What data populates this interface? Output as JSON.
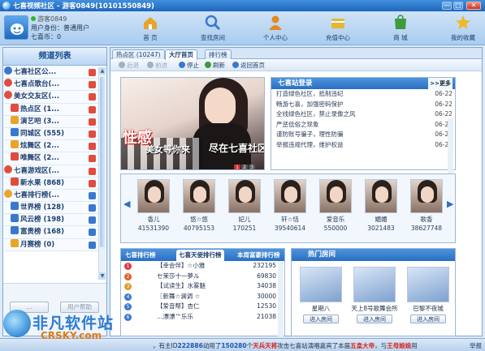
{
  "window": {
    "title": "七喜视频社区 - 游客0849(10101550849)",
    "min": "—",
    "max": "□",
    "close": "✕"
  },
  "user": {
    "name": "游客0849",
    "type": "用户身份：普通用户",
    "coins": "七喜币：0"
  },
  "nav": [
    {
      "label": "首 页",
      "icon": "home-icon",
      "color": "#e9a42a"
    },
    {
      "label": "查找房间",
      "icon": "search-icon",
      "color": "#3a78cf"
    },
    {
      "label": "个人中心",
      "icon": "person-icon",
      "color": "#e28b1e"
    },
    {
      "label": "充值中心",
      "icon": "recharge-icon",
      "color": "#e6b532"
    },
    {
      "label": "商 城",
      "icon": "shop-icon",
      "color": "#3e9a3b"
    },
    {
      "label": "我的收藏",
      "icon": "star-icon",
      "color": "#f0b72a"
    }
  ],
  "left": {
    "title": "频道列表",
    "channels": [
      {
        "label": "七喜社区公...",
        "kind": "cat",
        "color": "#3a78cf",
        "badge": "red"
      },
      {
        "label": "七喜点歌台(...",
        "kind": "cat",
        "color": "#e04d3e",
        "badge": "red"
      },
      {
        "label": "美女交友区(...",
        "kind": "cat",
        "color": "#e04d3e",
        "badge": "red"
      },
      {
        "label": "热点区 (1...",
        "kind": "sub",
        "color": "#e04d3e",
        "badge": "red"
      },
      {
        "label": "演艺吧 (3...",
        "kind": "sub",
        "color": "#e9a42a",
        "badge": "red"
      },
      {
        "label": "同城区 (555)",
        "kind": "sub",
        "color": "#3a78cf",
        "badge": "red"
      },
      {
        "label": "炫舞区 (2...",
        "kind": "sub",
        "color": "#e9a42a",
        "badge": "red"
      },
      {
        "label": "唯舞区 (2...",
        "kind": "sub",
        "color": "#e04d3e",
        "badge": "red"
      },
      {
        "label": "七喜游戏区(...",
        "kind": "cat",
        "color": "#e04d3e",
        "badge": "red"
      },
      {
        "label": "新水果 (868)",
        "kind": "sub",
        "color": "#e04d3e",
        "badge": "red"
      },
      {
        "label": "七喜排行榜(...",
        "kind": "cat",
        "color": "#e9a42a",
        "badge": "blue"
      },
      {
        "label": "世界榜 (128)",
        "kind": "sub",
        "color": "#3a78cf",
        "badge": "blue"
      },
      {
        "label": "风云榜 (198)",
        "kind": "sub",
        "color": "#3a78cf",
        "badge": "blue"
      },
      {
        "label": "富贵榜 (168)",
        "kind": "sub",
        "color": "#3a78cf",
        "badge": "blue"
      },
      {
        "label": "月赛榜 (0)",
        "kind": "sub",
        "color": "#e9a42a",
        "badge": "blue"
      }
    ],
    "btn_left": "…",
    "btn_right": "用户帮助"
  },
  "tabs": [
    {
      "label": "热点区 (10247)",
      "active": false
    },
    {
      "label": "大厅首页",
      "active": true
    },
    {
      "label": "排行榜",
      "active": false
    }
  ],
  "toolbar": [
    {
      "label": "后退",
      "off": true,
      "color": "#9fb2c8"
    },
    {
      "label": "前进",
      "off": true,
      "color": "#9fb2c8"
    },
    {
      "label": "停止",
      "off": false,
      "color": "#3a78cf"
    },
    {
      "label": "刷新",
      "off": false,
      "color": "#3e9a3b"
    },
    {
      "label": "返回首页",
      "off": false,
      "color": "#3a78cf"
    }
  ],
  "banner": {
    "big": "性感",
    "sub": "美女等你来",
    "sub2": "尽在七喜社区",
    "pages": [
      "1",
      "2",
      "3"
    ]
  },
  "news": {
    "title": "七喜站登录",
    "more": ">>更多",
    "items": [
      {
        "text": "打造绿色社区，抵制违纪",
        "date": "06-22"
      },
      {
        "text": "畅游七喜，加强密码保护",
        "date": "06-22"
      },
      {
        "text": "全线绿色社区，禁止录像之风",
        "date": "06-22"
      },
      {
        "text": "严惩低俗之现象",
        "date": "06-22"
      },
      {
        "text": "谨防账号骗子，理性防骗",
        "date": "06-22"
      },
      {
        "text": "举报违规代理，维护权益",
        "date": "06-22"
      }
    ]
  },
  "stars": [
    {
      "name": "香儿",
      "value": "41531390"
    },
    {
      "name": "悠☆悠",
      "value": "40795153"
    },
    {
      "name": "妃儿",
      "value": "170251"
    },
    {
      "name": "轩☆恬",
      "value": "39540614"
    },
    {
      "name": "爱音乐",
      "value": "550000"
    },
    {
      "name": "媚媚",
      "value": "3021483"
    },
    {
      "name": "歌香",
      "value": "38627748"
    }
  ],
  "ranking": {
    "tabs": [
      "七喜排行榜",
      "七喜天使排行榜",
      "本周富豪排行榜"
    ],
    "rows": [
      {
        "name": "【幸会伴】☆小雅",
        "value": "232195"
      },
      {
        "name": "セ茉莎十一夢ル",
        "value": "69830"
      },
      {
        "name": "【试读生】水雾魅",
        "value": "34038"
      },
      {
        "name": "〖新舞☆澜调 ☆",
        "value": "30000"
      },
      {
        "name": "【爱音帮】杏仁",
        "value": "12530"
      },
      {
        "name": "…漂漂™乐乐",
        "value": "21038"
      }
    ]
  },
  "rooms": {
    "title": "热门房间",
    "items": [
      {
        "name": "星期八",
        "button": "进入房间"
      },
      {
        "name": "天上8号歌舞会所",
        "button": "进入房间"
      },
      {
        "name": "巴黎不夜城",
        "button": "进入房间"
      }
    ]
  },
  "status": {
    "p1": "，有主ID",
    "id": "222886",
    "p2": "动用了",
    "n1": "150280",
    "p3": "个",
    "gift": "天兵天将",
    "p4": "攻击七喜站演唱嘉宾了本届",
    "title1": "五皇大帝",
    "p5": "，与",
    "title2": "王母娘娘",
    "p6": "用",
    "feedback": "举报"
  },
  "watermark": {
    "text": "非凡软件站",
    "url": "CRSKY.com"
  }
}
